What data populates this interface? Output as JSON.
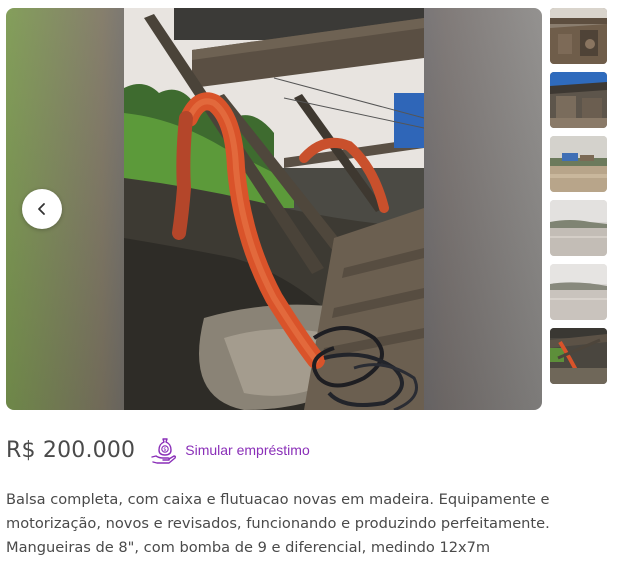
{
  "listing": {
    "price": "R$ 200.000",
    "loan_link_label": "Simular empréstimo",
    "description": "Balsa completa, com caixa e flutuacao novas em madeira. Equipamente e motorização, novos e revisados, funcionando e produzindo perfeitamente. Mangueiras de 8\", com bomba de 9 e diferencial, medindo 12x7m"
  },
  "gallery": {
    "thumbnails": [
      {
        "icon": "photo-dredge-deck"
      },
      {
        "icon": "photo-dredge-engine"
      },
      {
        "icon": "photo-river-boat"
      },
      {
        "icon": "photo-river-shore"
      },
      {
        "icon": "photo-river-shore-2"
      },
      {
        "icon": "photo-hoses"
      }
    ]
  },
  "colors": {
    "accent": "#8a2fb8",
    "text": "#4a4a4a",
    "hose": "#d9532a"
  }
}
